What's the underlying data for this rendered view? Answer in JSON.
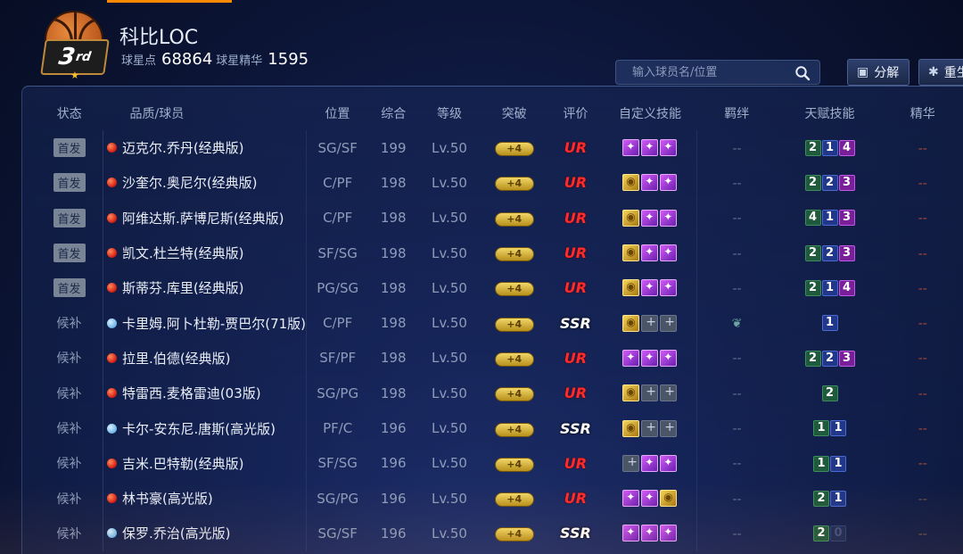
{
  "profile": {
    "name": "科比LOC",
    "rank_text": "3",
    "rank_suffix": "rd",
    "points_label": "球星点",
    "points_value": "68864",
    "essence_label": "球星精华",
    "essence_value": "1595"
  },
  "search": {
    "placeholder": "输入球员名/位置"
  },
  "buttons": {
    "split_label": "分解",
    "reset_label": "重生"
  },
  "table": {
    "headers": {
      "status": "状态",
      "player": "品质/球员",
      "position": "位置",
      "overall": "综合",
      "level": "等级",
      "breakthrough": "突破",
      "rating": "评价",
      "skills": "自定义技能",
      "bond": "羁绊",
      "talent": "天赋技能",
      "essence": "精华"
    },
    "breakthrough_label": "+4",
    "rows": [
      {
        "status": "首发",
        "quality": "red",
        "name": "迈克尔.乔丹(经典版)",
        "position": "SG/SF",
        "overall": "199",
        "level": "Lv.50",
        "rating": "UR",
        "skills": [
          "purple",
          "purple",
          "purple"
        ],
        "bond": "--",
        "talents": [
          {
            "v": "2",
            "c": "green"
          },
          {
            "v": "1",
            "c": "blue"
          },
          {
            "v": "4",
            "c": "purple"
          }
        ],
        "essence": "--"
      },
      {
        "status": "首发",
        "quality": "red",
        "name": "沙奎尔.奥尼尔(经典版)",
        "position": "C/PF",
        "overall": "198",
        "level": "Lv.50",
        "rating": "UR",
        "skills": [
          "gold",
          "purple",
          "purple"
        ],
        "bond": "--",
        "talents": [
          {
            "v": "2",
            "c": "green"
          },
          {
            "v": "2",
            "c": "blue"
          },
          {
            "v": "3",
            "c": "purple"
          }
        ],
        "essence": "--"
      },
      {
        "status": "首发",
        "quality": "red",
        "name": "阿维达斯.萨博尼斯(经典版)",
        "position": "C/PF",
        "overall": "198",
        "level": "Lv.50",
        "rating": "UR",
        "skills": [
          "gold",
          "purple",
          "purple"
        ],
        "bond": "--",
        "talents": [
          {
            "v": "4",
            "c": "green"
          },
          {
            "v": "1",
            "c": "blue"
          },
          {
            "v": "3",
            "c": "purple"
          }
        ],
        "essence": "--"
      },
      {
        "status": "首发",
        "quality": "red",
        "name": "凯文.杜兰特(经典版)",
        "position": "SF/SG",
        "overall": "198",
        "level": "Lv.50",
        "rating": "UR",
        "skills": [
          "gold",
          "purple",
          "purple"
        ],
        "bond": "--",
        "talents": [
          {
            "v": "2",
            "c": "green"
          },
          {
            "v": "2",
            "c": "blue"
          },
          {
            "v": "3",
            "c": "purple"
          }
        ],
        "essence": "--"
      },
      {
        "status": "首发",
        "quality": "red",
        "name": "斯蒂芬.库里(经典版)",
        "position": "PG/SG",
        "overall": "198",
        "level": "Lv.50",
        "rating": "UR",
        "skills": [
          "gold",
          "purple",
          "purple"
        ],
        "bond": "--",
        "talents": [
          {
            "v": "2",
            "c": "green"
          },
          {
            "v": "1",
            "c": "blue"
          },
          {
            "v": "4",
            "c": "purple"
          }
        ],
        "essence": "--"
      },
      {
        "status": "候补",
        "quality": "blue",
        "name": "卡里姆.阿卜杜勒-贾巴尔(71版)",
        "position": "C/PF",
        "overall": "198",
        "level": "Lv.50",
        "rating": "SSR",
        "skills": [
          "gold",
          "empty",
          "empty"
        ],
        "bond": "icon",
        "talents": [
          {
            "v": "1",
            "c": "blue"
          }
        ],
        "essence": "--"
      },
      {
        "status": "候补",
        "quality": "red",
        "name": "拉里.伯德(经典版)",
        "position": "SF/PF",
        "overall": "198",
        "level": "Lv.50",
        "rating": "UR",
        "skills": [
          "purple",
          "purple",
          "purple"
        ],
        "bond": "--",
        "talents": [
          {
            "v": "2",
            "c": "green"
          },
          {
            "v": "2",
            "c": "blue"
          },
          {
            "v": "3",
            "c": "purple"
          }
        ],
        "essence": "--"
      },
      {
        "status": "候补",
        "quality": "red",
        "name": "特雷西.麦格雷迪(03版)",
        "position": "SG/PG",
        "overall": "198",
        "level": "Lv.50",
        "rating": "UR",
        "skills": [
          "gold",
          "empty",
          "empty"
        ],
        "bond": "--",
        "talents": [
          {
            "v": "2",
            "c": "green"
          }
        ],
        "essence": "--"
      },
      {
        "status": "候补",
        "quality": "blue",
        "name": "卡尔-安东尼.唐斯(高光版)",
        "position": "PF/C",
        "overall": "196",
        "level": "Lv.50",
        "rating": "SSR",
        "skills": [
          "gold",
          "empty",
          "empty"
        ],
        "bond": "--",
        "talents": [
          {
            "v": "1",
            "c": "green"
          },
          {
            "v": "1",
            "c": "blue"
          }
        ],
        "essence": "--"
      },
      {
        "status": "候补",
        "quality": "red",
        "name": "吉米.巴特勒(经典版)",
        "position": "SF/SG",
        "overall": "196",
        "level": "Lv.50",
        "rating": "UR",
        "skills": [
          "empty",
          "purple",
          "purple"
        ],
        "bond": "--",
        "talents": [
          {
            "v": "1",
            "c": "green"
          },
          {
            "v": "1",
            "c": "blue"
          }
        ],
        "essence": "--"
      },
      {
        "status": "候补",
        "quality": "red",
        "name": "林书豪(高光版)",
        "position": "SG/PG",
        "overall": "196",
        "level": "Lv.50",
        "rating": "UR",
        "skills": [
          "purple",
          "purple",
          "gold"
        ],
        "bond": "--",
        "talents": [
          {
            "v": "2",
            "c": "green"
          },
          {
            "v": "1",
            "c": "blue"
          }
        ],
        "essence": "--"
      },
      {
        "status": "候补",
        "quality": "blue",
        "name": "保罗.乔治(高光版)",
        "position": "SG/SF",
        "overall": "196",
        "level": "Lv.50",
        "rating": "SSR",
        "skills": [
          "purple",
          "purple",
          "purple"
        ],
        "bond": "--",
        "talents": [
          {
            "v": "2",
            "c": "green"
          },
          {
            "v": "0",
            "c": "dim"
          }
        ],
        "essence": "--"
      }
    ]
  }
}
